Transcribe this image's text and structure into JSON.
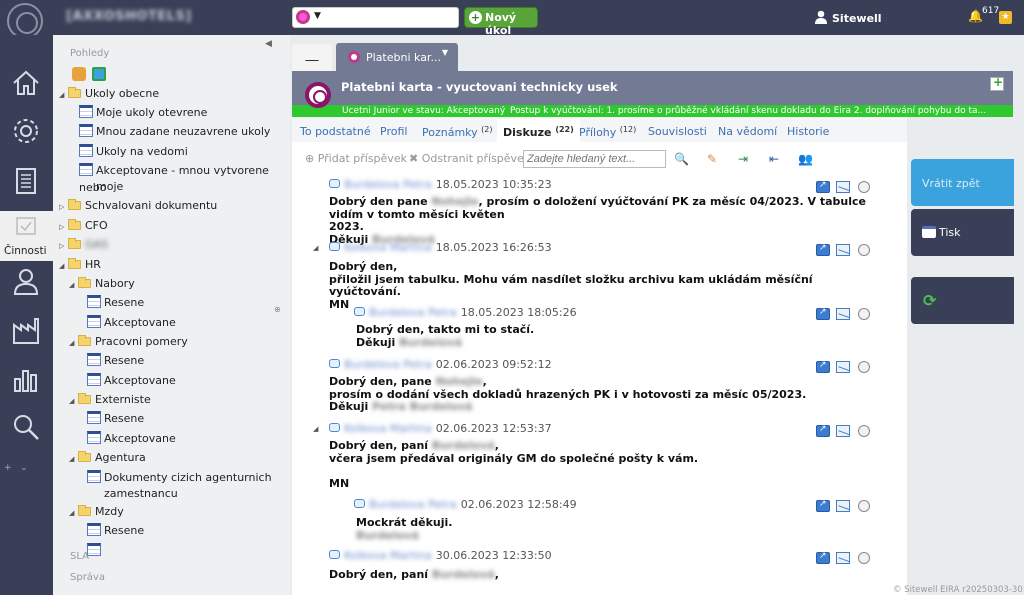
{
  "app": {
    "title": "[AXXOSHOTELS]",
    "user": "Sitewell",
    "notifications": "617",
    "new_task_label": "Nový úkol",
    "footer": "© Sitewell EIRA r20250303-301"
  },
  "rail": {
    "active_label": "Činnosti",
    "items": [
      "home-icon",
      "settings-icon",
      "document-icon",
      "activities-icon",
      "user-icon",
      "factory-icon",
      "chart-icon",
      "search-icon"
    ]
  },
  "tree": {
    "heading_views": "Pohledy",
    "heading_sla": "SLA",
    "heading_admin": "Správa",
    "items": [
      {
        "label": "Ukoly obecne"
      },
      {
        "label": "Moje ukoly otevrene"
      },
      {
        "label": "Mnou zadane neuzavrene ukoly"
      },
      {
        "label": "Ukoly na vedomi"
      },
      {
        "label": "Akceptovane - mnou vytvorene nebo"
      },
      {
        "label": "moje"
      },
      {
        "label": "Schvalovani dokumentu"
      },
      {
        "label": "CFO"
      },
      {
        "label": "GAS"
      },
      {
        "label": "HR"
      },
      {
        "label": "Nabory"
      },
      {
        "label": "Resene"
      },
      {
        "label": "Akceptovane"
      },
      {
        "label": "Pracovni pomery"
      },
      {
        "label": "Resene"
      },
      {
        "label": "Akceptovane"
      },
      {
        "label": "Externiste"
      },
      {
        "label": "Resene"
      },
      {
        "label": "Akceptovane"
      },
      {
        "label": "Agentura"
      },
      {
        "label": "Dokumenty cizich agenturnich"
      },
      {
        "label": "zamestnancu"
      },
      {
        "label": "Mzdy"
      },
      {
        "label": "Resene"
      }
    ]
  },
  "tabs": {
    "blank": "__",
    "active": "Platebni kar..."
  },
  "task": {
    "title": "Platebni karta - vyuctovani technicky usek",
    "status_left": "Ucetni Junior ve stavu: Akceptovaný",
    "status_right": "Postup k vyúčtování: 1. prosíme o průběžné vkládání skenu dokladu do Eira 2. doplňování pohybu do ta..."
  },
  "subtabs": [
    {
      "label": "To podstatné",
      "count": ""
    },
    {
      "label": "Profil",
      "count": ""
    },
    {
      "label": "Poznámky",
      "count": "(2)"
    },
    {
      "label": "Diskuze",
      "count": "(22)"
    },
    {
      "label": "Přílohy",
      "count": "(12)"
    },
    {
      "label": "Souvislosti",
      "count": ""
    },
    {
      "label": "Na vědomí",
      "count": ""
    },
    {
      "label": "Historie",
      "count": ""
    }
  ],
  "toolbar": {
    "add_post": "Přidat příspěvek",
    "remove_post": "Odstranit příspěvek",
    "search_placeholder": "Zadejte hledaný text..."
  },
  "posts": [
    {
      "author": "Burdelova Petra",
      "date": "18.05.2023 10:35:23",
      "l1a": "Dobrý den pane ",
      "l1name": "Nohejle",
      "l1b": ", prosím o doložení vyúčtování PK za měsíc 04/2023. V tabulce vidím v tomto měsíci květen",
      "l2": "2023.",
      "l3a": "Děkuji ",
      "l3name": "Burdelová"
    },
    {
      "author": "Kolkova Martina",
      "date": "18.05.2023 16:26:53",
      "l1": "Dobrý den,",
      "l2": "přiložil jsem tabulku. Mohu vám nasdílet složku archivu kam ukládám měsíční vyúčtování.",
      "l3": "MN"
    },
    {
      "author": "Burdelova Petra",
      "date": "18.05.2023 18:05:26",
      "l1": "Dobrý den, takto mi to stačí.",
      "l2a": "Děkuji ",
      "l2name": "Burdelová"
    },
    {
      "author": "Burdelova Petra",
      "date": "02.06.2023 09:52:12",
      "l1a": "Dobrý den, pane ",
      "l1name": "Nohejle",
      "l1b": ",",
      "l2": "prosím o dodání všech dokladů hrazených PK i v hotovosti za měsíc 05/2023.",
      "l3a": "Děkuji ",
      "l3name": "Petra Burdelová"
    },
    {
      "author": "Kolkova Martina",
      "date": "02.06.2023 12:53:37",
      "l1a": "Dobrý den, paní ",
      "l1name": "Burdelová",
      "l1b": ",",
      "l2": "včera jsem předával originály GM do společné pošty k vám.",
      "l3": "MN"
    },
    {
      "author": "Burdelova Petra",
      "date": "02.06.2023 12:58:49",
      "l1": "Mockrát děkuji.",
      "l2name": "Burdelová"
    },
    {
      "author": "Kolkova Martina",
      "date": "30.06.2023 12:33:50",
      "l1a": "Dobrý den, paní ",
      "l1name": "Burdelová",
      "l1b": ","
    }
  ],
  "side_buttons": {
    "return": "Vrátit zpět",
    "print": "Tisk"
  }
}
